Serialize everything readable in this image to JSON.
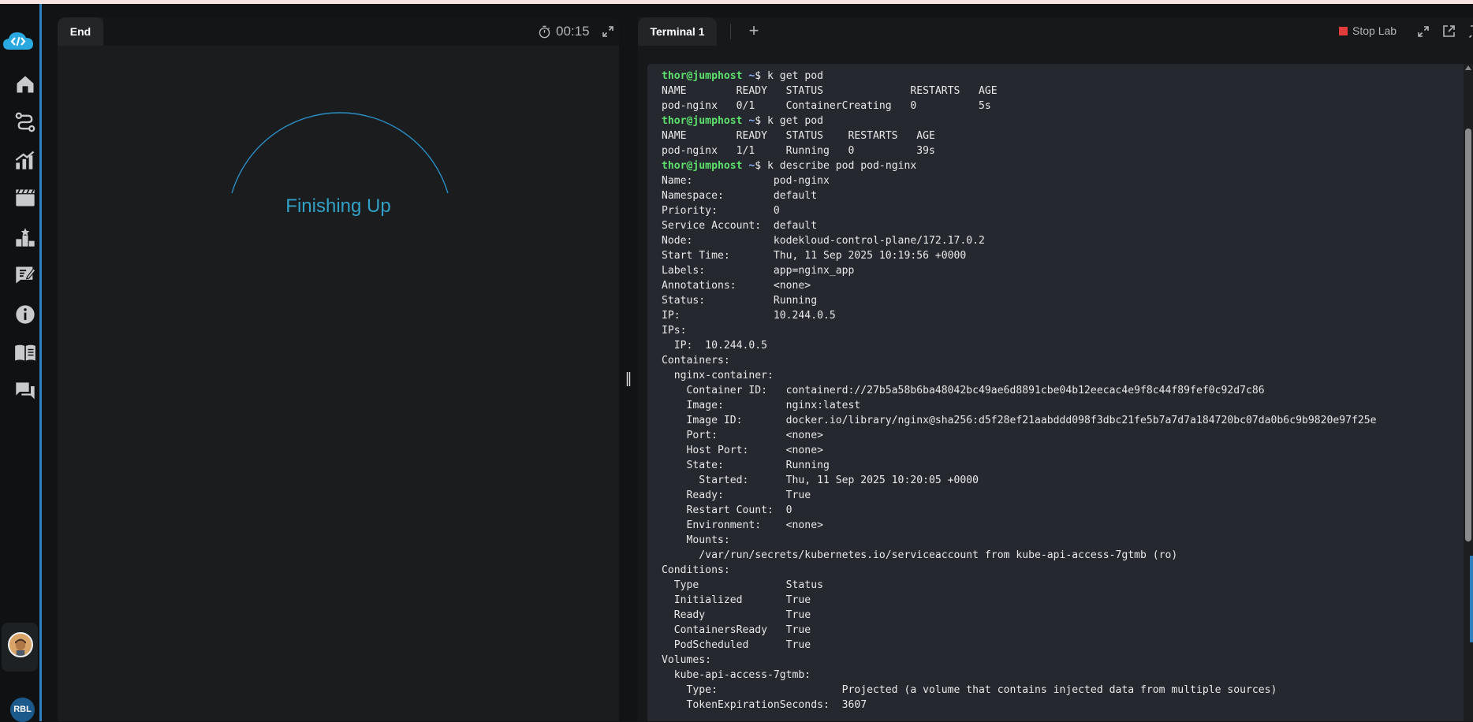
{
  "left_pane": {
    "tab_label": "End",
    "timer": "00:15",
    "status_text": "Finishing Up"
  },
  "right_pane": {
    "tab_label": "Terminal 1",
    "add_tab_label": "+",
    "stop_lab_label": "Stop Lab"
  },
  "sidebar": {
    "items": [
      {
        "icon": "home-icon"
      },
      {
        "icon": "route-icon"
      },
      {
        "icon": "progress-chart-icon"
      },
      {
        "icon": "video-icon"
      },
      {
        "icon": "leaderboard-icon"
      },
      {
        "icon": "notes-icon"
      },
      {
        "icon": "info-icon"
      },
      {
        "icon": "book-icon"
      },
      {
        "icon": "chat-icon"
      }
    ],
    "user_initials": "RBL"
  },
  "colors": {
    "accent": "#2f7fbf",
    "status_text": "#32a1c8",
    "prompt_user": "#5ce06b",
    "prompt_path": "#8fb4ff",
    "stop": "#e23b3b"
  },
  "terminal": {
    "prompt_user": "thor@jumphost",
    "prompt_path": "~",
    "prompt_symbol": "$",
    "lines": [
      {
        "prompt": true,
        "text": " k get pod"
      },
      {
        "text": "NAME        READY   STATUS              RESTARTS   AGE"
      },
      {
        "text": "pod-nginx   0/1     ContainerCreating   0          5s"
      },
      {
        "prompt": true,
        "text": " k get pod"
      },
      {
        "text": "NAME        READY   STATUS    RESTARTS   AGE"
      },
      {
        "text": "pod-nginx   1/1     Running   0          39s"
      },
      {
        "prompt": true,
        "text": " k describe pod pod-nginx"
      },
      {
        "text": "Name:             pod-nginx"
      },
      {
        "text": "Namespace:        default"
      },
      {
        "text": "Priority:         0"
      },
      {
        "text": "Service Account:  default"
      },
      {
        "text": "Node:             kodekloud-control-plane/172.17.0.2"
      },
      {
        "text": "Start Time:       Thu, 11 Sep 2025 10:19:56 +0000"
      },
      {
        "text": "Labels:           app=nginx_app"
      },
      {
        "text": "Annotations:      <none>"
      },
      {
        "text": "Status:           Running"
      },
      {
        "text": "IP:               10.244.0.5"
      },
      {
        "text": "IPs:"
      },
      {
        "text": "  IP:  10.244.0.5"
      },
      {
        "text": "Containers:"
      },
      {
        "text": "  nginx-container:"
      },
      {
        "text": "    Container ID:   containerd://27b5a58b6ba48042bc49ae6d8891cbe04b12eecac4e9f8c44f89fef0c92d7c86"
      },
      {
        "text": "    Image:          nginx:latest"
      },
      {
        "text": "    Image ID:       docker.io/library/nginx@sha256:d5f28ef21aabddd098f3dbc21fe5b7a7d7a184720bc07da0b6c9b9820e97f25e"
      },
      {
        "text": "    Port:           <none>"
      },
      {
        "text": "    Host Port:      <none>"
      },
      {
        "text": "    State:          Running"
      },
      {
        "text": "      Started:      Thu, 11 Sep 2025 10:20:05 +0000"
      },
      {
        "text": "    Ready:          True"
      },
      {
        "text": "    Restart Count:  0"
      },
      {
        "text": "    Environment:    <none>"
      },
      {
        "text": "    Mounts:"
      },
      {
        "text": "      /var/run/secrets/kubernetes.io/serviceaccount from kube-api-access-7gtmb (ro)"
      },
      {
        "text": "Conditions:"
      },
      {
        "text": "  Type              Status"
      },
      {
        "text": "  Initialized       True"
      },
      {
        "text": "  Ready             True"
      },
      {
        "text": "  ContainersReady   True"
      },
      {
        "text": "  PodScheduled      True"
      },
      {
        "text": "Volumes:"
      },
      {
        "text": "  kube-api-access-7gtmb:"
      },
      {
        "text": "    Type:                    Projected (a volume that contains injected data from multiple sources)"
      },
      {
        "text": "    TokenExpirationSeconds:  3607"
      }
    ]
  }
}
